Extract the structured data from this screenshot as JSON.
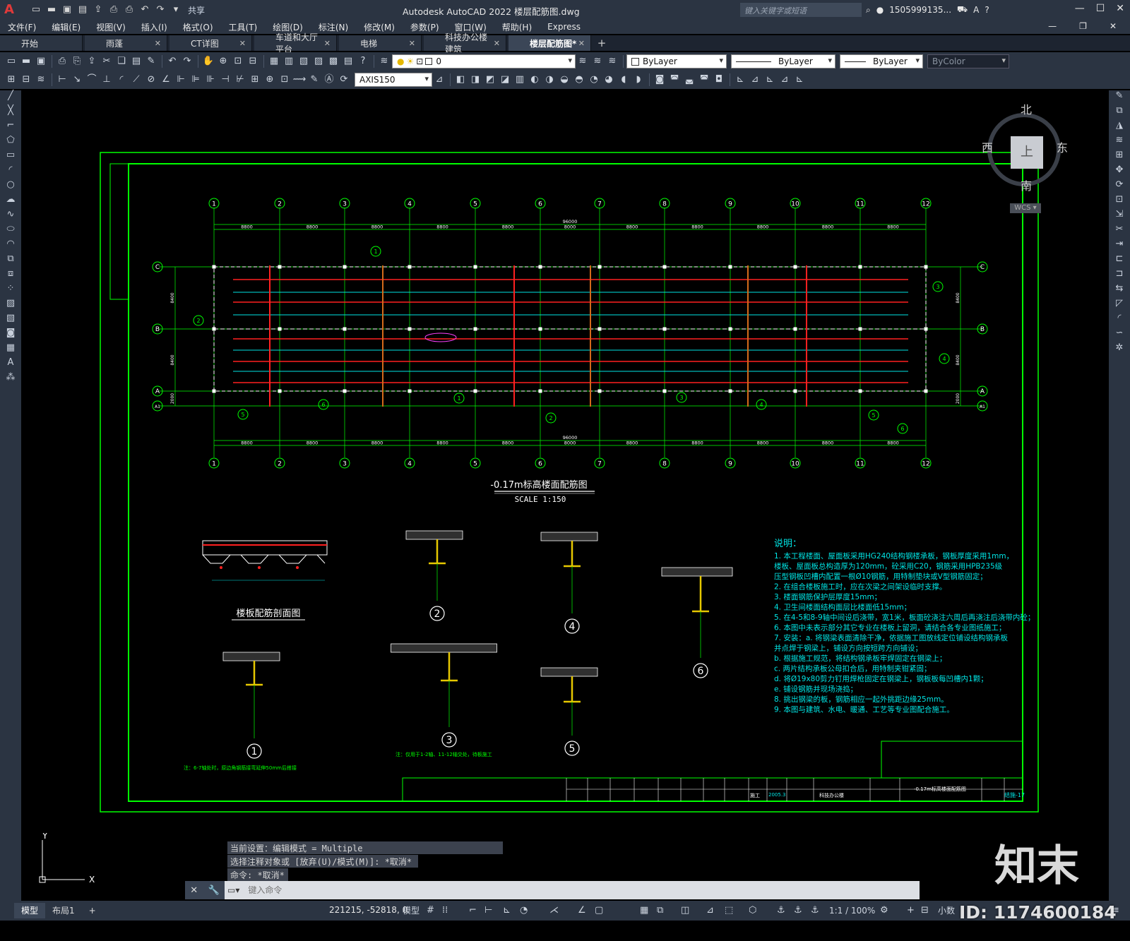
{
  "app": {
    "title": "Autodesk AutoCAD 2022   楼层配筋图.dwg",
    "share": "共享",
    "search_placeholder": "键入关键字或短语",
    "user": "1505999135...",
    "logo": "A"
  },
  "menu": [
    "文件(F)",
    "编辑(E)",
    "视图(V)",
    "插入(I)",
    "格式(O)",
    "工具(T)",
    "绘图(D)",
    "标注(N)",
    "修改(M)",
    "参数(P)",
    "窗口(W)",
    "帮助(H)",
    "Express"
  ],
  "tabs": [
    {
      "label": "开始",
      "active": false
    },
    {
      "label": "雨蓬",
      "active": false
    },
    {
      "label": "CT详图",
      "active": false
    },
    {
      "label": "车道和大厅平台",
      "active": false
    },
    {
      "label": "电梯",
      "active": false
    },
    {
      "label": "科技办公楼建筑",
      "active": false
    },
    {
      "label": "楼层配筋图*",
      "active": true
    }
  ],
  "toolbar": {
    "layer_value": "0",
    "color_value": "ByLayer",
    "linetype_value": "ByLayer",
    "lineweight_value": "ByLayer",
    "plotstyle_value": "ByColor",
    "dimstyle_value": "AXIS150"
  },
  "viewcube": {
    "north": "北",
    "south": "南",
    "west": "西",
    "east": "东",
    "face": "上",
    "wcs": "WCS"
  },
  "drawing": {
    "grid_numbers": [
      "1",
      "2",
      "3",
      "4",
      "5",
      "6",
      "7",
      "8",
      "9",
      "10",
      "11",
      "12"
    ],
    "grid_letters": [
      "C",
      "B",
      "A",
      "A1"
    ],
    "bay_dims": [
      "8800",
      "8800",
      "8800",
      "8800",
      "8800",
      "8000",
      "8800",
      "8800",
      "8800",
      "8800",
      "8800"
    ],
    "total_dim": "96000",
    "row_dims": [
      "8400",
      "8400",
      "2000"
    ],
    "plan_title": "-0.17m标高楼面配筋图",
    "plan_scale": "SCALE 1:150",
    "section_title": "楼板配筋剖面图",
    "detail_numbers": [
      "1",
      "2",
      "3",
      "4",
      "5",
      "6"
    ],
    "notes_title": "说明：",
    "notes": [
      "1. 本工程楼面、屋面板采用HG240结构钢楼承板，钢板厚度采用1mm，",
      "   楼板、屋面板总构造厚为120mm，砼采用C20，钢筋采用HPB235级",
      "   压型钢板凹槽内配置一根Ø10钢筋，用特制垫块或V型钢筋固定；",
      "2. 在组合楼板施工时，应在次梁之间架设临时支撑。",
      "3. 楼面钢筋保护层厚度15mm；",
      "4. 卫生间楼面结构面层比楼面低15mm；",
      "5. 在4-5和8-9轴中间设后浇带，宽1米，板面砼浇注六周后再浇注后浇带内砼；",
      "6. 本图中未表示部分其它专业在楼板上留洞，请结合各专业图纸施工；",
      "7. 安装：a. 将钢梁表面清除干净，依据施工图放线定位铺设结构钢承板",
      "      并点焊于钢梁上，铺设方向按短跨方向铺设；",
      "      b. 根据施工规范，将结构钢承板牢焊固定在钢梁上；",
      "      c. 两片结构承板公母扣合后，用特制夹钳紧固；",
      "      d. 将Ø19x80剪力钉用焊枪固定在钢梁上，钢板板每凹槽内1颗；",
      "      e. 铺设钢筋并现场浇捣；",
      "8. 挑出钢梁的板，钢筋相应一起外挑距边缘25mm。",
      "9. 本图与建筑、水电、暖通、工艺等专业图配合施工。"
    ],
    "titleblock": {
      "project": "科技办公楼",
      "drawing_name": "-0.17m标高楼面配筋图",
      "stage": "施工",
      "date": "2005.3",
      "sheet_no": "结施-17"
    },
    "detail_notes": [
      "注：6-7轴处时，原边角钢筋接弯延伸50mm后搭接",
      "注：仅用于1-2轴、11-12轴交处，待板施工"
    ]
  },
  "command": {
    "history": [
      "当前设置：编辑模式 = Multiple",
      "选择注释对象或 [放弃(U)/模式(M)]: *取消*",
      "命令: *取消*"
    ],
    "placeholder": "键入命令"
  },
  "status": {
    "layouts": [
      "模型",
      "布局1"
    ],
    "coords": "221215, -52818, 0",
    "model_label": "模型",
    "scale": "1:1 / 100%",
    "units": "小数"
  },
  "watermark": {
    "brand": "知末",
    "id": "ID: 1174600184"
  },
  "colors": {
    "ui_bg": "#2b3442",
    "grid_green": "#00ff00",
    "red_rebar": "#ff2020",
    "cyan": "#00e5e5",
    "orange": "#d46a1a",
    "white": "#ffffff"
  }
}
